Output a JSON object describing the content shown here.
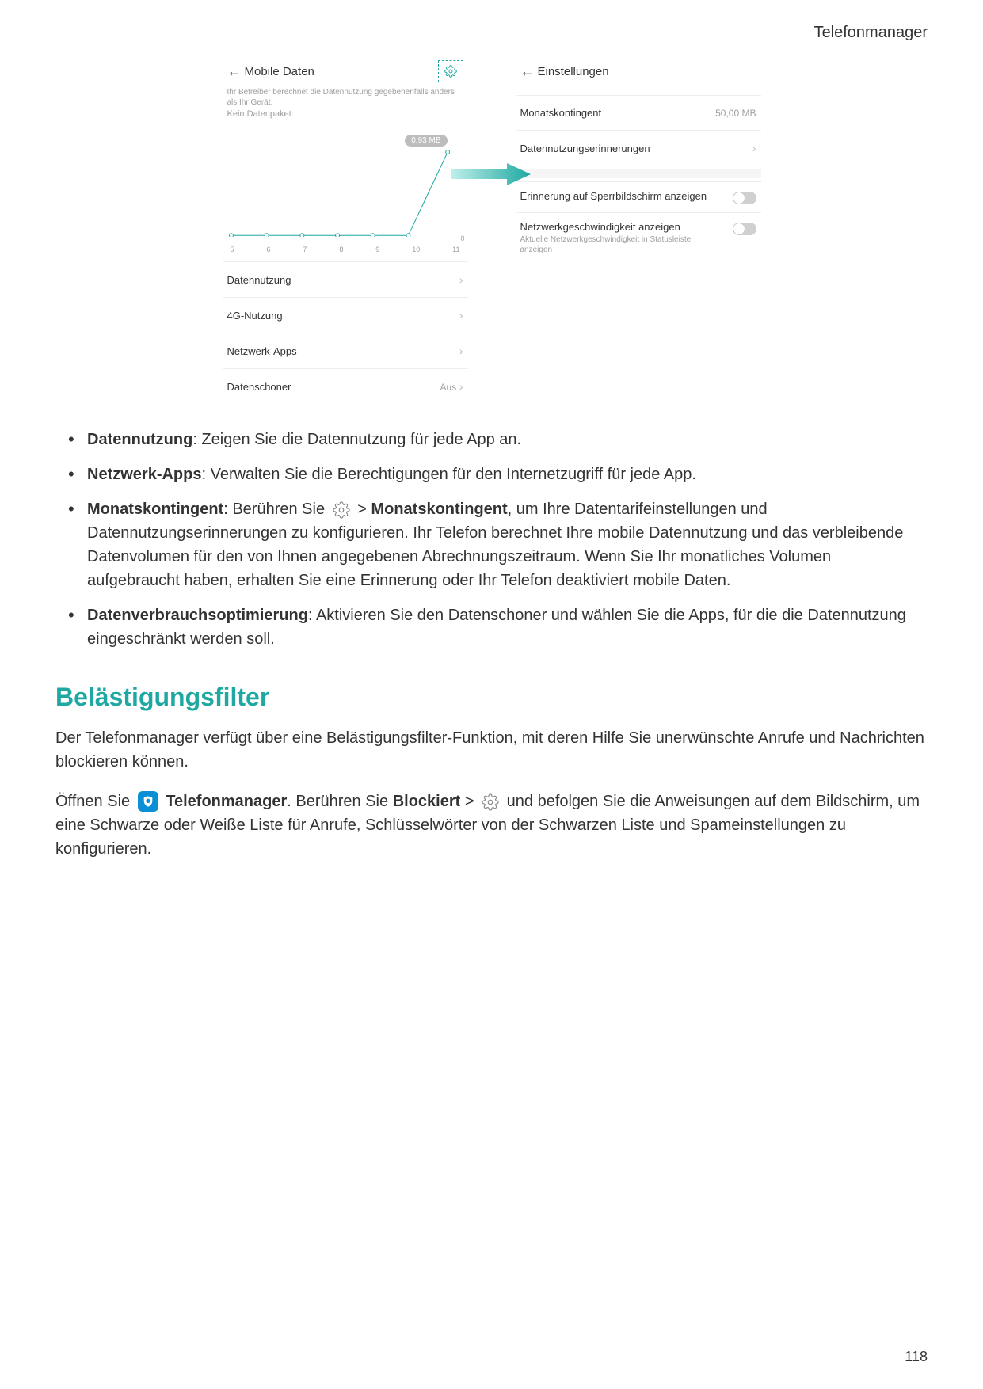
{
  "header": {
    "section": "Telefonmanager"
  },
  "screenshots": {
    "left": {
      "title": "Mobile Daten",
      "disclaimer": "Ihr Betreiber berechnet die Datennutzung gegebenenfalls anders als Ihr Gerät.",
      "sub": "Kein Datenpaket",
      "badge": "0,93 MB",
      "x": [
        "5",
        "6",
        "7",
        "8",
        "9",
        "10",
        "11"
      ],
      "zero": "0",
      "rows": {
        "r1": "Datennutzung",
        "r2": "4G-Nutzung",
        "r3": "Netzwerk-Apps",
        "r4": "Datenschoner",
        "r4val": "Aus"
      }
    },
    "right": {
      "title": "Einstellungen",
      "r1": {
        "label": "Monatskontingent",
        "val": "50,00 MB"
      },
      "r2": {
        "label": "Datennutzungserinnerungen"
      },
      "r3": {
        "label": "Erinnerung auf Sperrbildschirm anzeigen"
      },
      "r4": {
        "label": "Netzwerkgeschwindigkeit anzeigen",
        "sub": "Aktuelle Netzwerkgeschwindigkeit in Statusleiste anzeigen"
      }
    }
  },
  "chart_data": {
    "type": "line",
    "title": "",
    "xlabel": "",
    "ylabel": "",
    "x": [
      5,
      6,
      7,
      8,
      9,
      10,
      11
    ],
    "values": [
      0,
      0,
      0,
      0,
      0,
      0,
      0.93
    ],
    "ylim": [
      0,
      1
    ],
    "unit": "MB"
  },
  "bullets": {
    "b1": {
      "bold": "Datennutzung",
      "rest": ": Zeigen Sie die Datennutzung für jede App an."
    },
    "b2": {
      "bold": "Netzwerk-Apps",
      "rest": ": Verwalten Sie die Berechtigungen für den Internetzugriff für jede App."
    },
    "b3": {
      "bold": "Monatskontingent",
      "p1": ": Berühren Sie ",
      "p2": " > ",
      "bold2": "Monatskontingent",
      "p3": ", um Ihre Datentarifeinstellungen und Datennutzungserinnerungen zu konfigurieren. Ihr Telefon berechnet Ihre mobile Datennutzung und das verbleibende Datenvolumen für den von Ihnen angegebenen Abrechnungszeitraum. Wenn Sie Ihr monatliches Volumen aufgebraucht haben, erhalten Sie eine Erinnerung oder Ihr Telefon deaktiviert mobile Daten."
    },
    "b4": {
      "bold": "Datenverbrauchsoptimierung",
      "rest": ": Aktivieren Sie den Datenschoner und wählen Sie die Apps, für die die Datennutzung eingeschränkt werden soll."
    }
  },
  "section2": {
    "heading": "Belästigungsfilter",
    "p1": "Der Telefonmanager verfügt über eine Belästigungsfilter-Funktion, mit deren Hilfe Sie unerwünschte Anrufe und Nachrichten blockieren können.",
    "p2a": "Öffnen Sie ",
    "p2b": "Telefonmanager",
    "p2c": ". Berühren Sie ",
    "p2d": "Blockiert",
    "p2e": " > ",
    "p2f": " und befolgen Sie die Anweisungen auf dem Bildschirm, um eine Schwarze oder Weiße Liste für Anrufe, Schlüsselwörter von der Schwarzen Liste und Spameinstellungen zu konfigurieren."
  },
  "pagenum": "118"
}
